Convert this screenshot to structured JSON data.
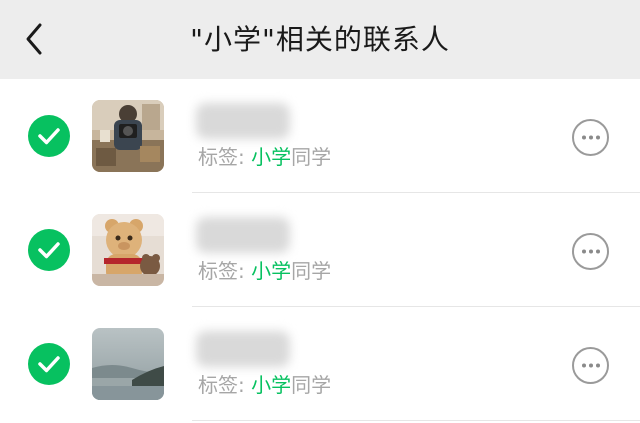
{
  "header": {
    "back_icon": "chevron-left-icon",
    "title": "\"小学\"相关的联系人"
  },
  "contacts": [
    {
      "checked": true,
      "tag_prefix": "标签: ",
      "tag_keyword": "小学",
      "tag_suffix": "同学",
      "avatar": "photo-person-with-camera",
      "more_icon": "more-dots-icon"
    },
    {
      "checked": true,
      "tag_prefix": "标签: ",
      "tag_keyword": "小学",
      "tag_suffix": "同学",
      "avatar": "photo-teddy-bear",
      "more_icon": "more-dots-icon"
    },
    {
      "checked": true,
      "tag_prefix": "标签: ",
      "tag_keyword": "小学",
      "tag_suffix": "同学",
      "avatar": "photo-misty-landscape",
      "more_icon": "more-dots-icon"
    }
  ],
  "colors": {
    "accent": "#07c160",
    "header_bg": "#ededed",
    "muted_text": "#a6a6a6"
  }
}
